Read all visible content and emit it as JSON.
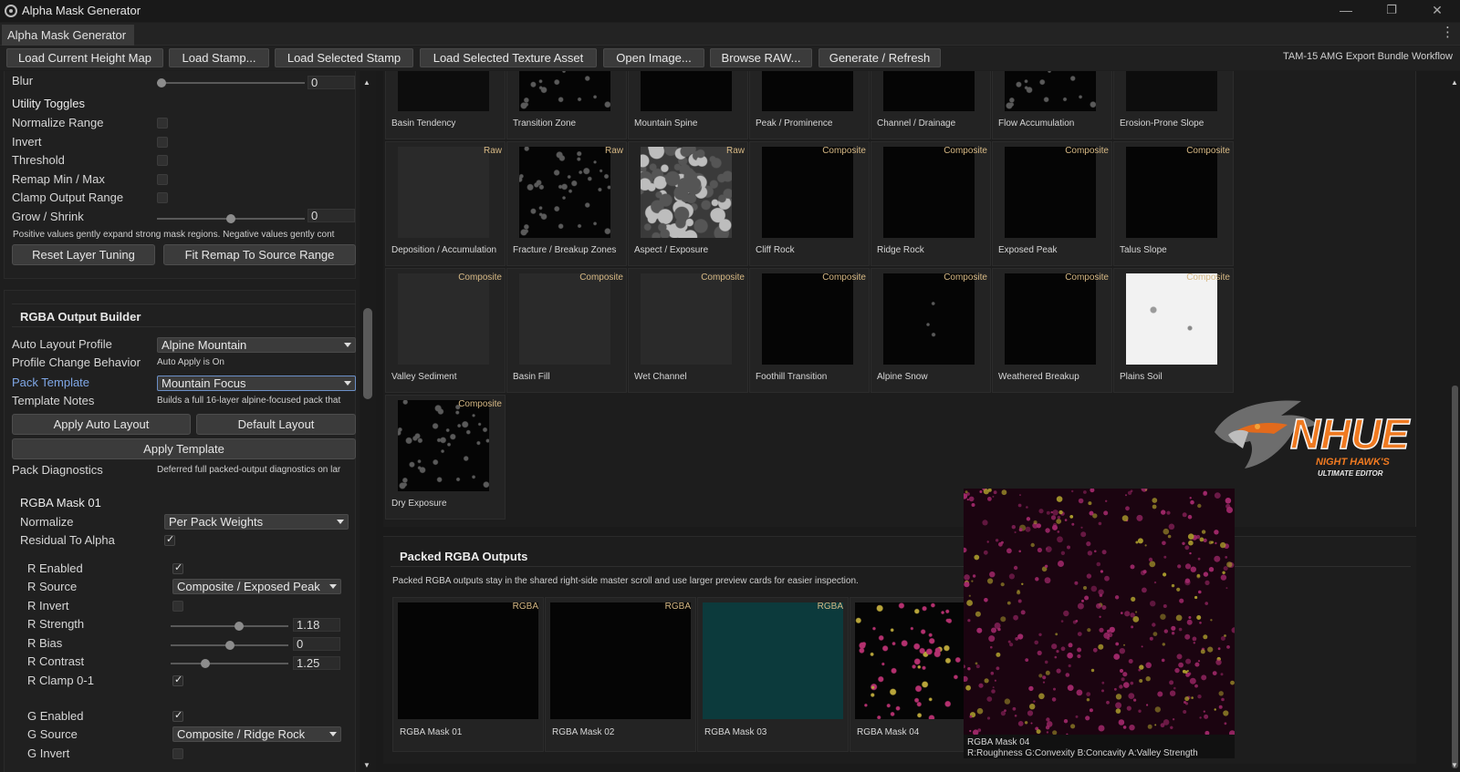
{
  "window": {
    "title": "Alpha Mask Generator",
    "minimize": "—",
    "maximize": "❐",
    "close": "✕"
  },
  "tabs": [
    {
      "label": "Alpha Mask Generator"
    }
  ],
  "tabbar": {
    "menu_glyph": "⋮"
  },
  "toolbar": {
    "buttons": [
      {
        "label": "Load Current Height Map"
      },
      {
        "label": "Load Stamp..."
      },
      {
        "label": "Load Selected Stamp"
      },
      {
        "label": "Load Selected Texture Asset"
      },
      {
        "label": "Open Image..."
      },
      {
        "label": "Browse RAW..."
      },
      {
        "label": "Generate / Refresh"
      }
    ],
    "right_label": "TAM-15 AMG Export Bundle Workflow"
  },
  "left": {
    "blur": {
      "label": "Blur",
      "value": "0",
      "level": 0.0
    },
    "utility_toggles": {
      "title": "Utility Toggles",
      "items": [
        {
          "label": "Normalize Range",
          "checked": false
        },
        {
          "label": "Invert",
          "checked": false
        },
        {
          "label": "Threshold",
          "checked": false
        },
        {
          "label": "Remap Min / Max",
          "checked": false
        },
        {
          "label": "Clamp Output Range",
          "checked": false
        }
      ]
    },
    "grow_shrink": {
      "label": "Grow / Shrink",
      "value": "0",
      "level": 0.5
    },
    "grow_note": "Positive values gently expand strong mask regions. Negative values gently cont",
    "reset_button": "Reset Layer Tuning",
    "fit_button": "Fit Remap To Source Range",
    "rgba_builder": {
      "title": "RGBA Output Builder",
      "auto_layout_profile": {
        "label": "Auto Layout Profile",
        "value": "Alpine Mountain"
      },
      "profile_change": {
        "label": "Profile Change Behavior",
        "value": "Auto Apply is On"
      },
      "pack_template": {
        "label": "Pack Template",
        "value": "Mountain Focus"
      },
      "template_notes": {
        "label": "Template Notes",
        "value": "Builds a full 16-layer alpine-focused pack that"
      },
      "apply_auto_layout": "Apply Auto Layout",
      "default_layout": "Default Layout",
      "apply_template": "Apply Template",
      "pack_diagnostics": {
        "label": "Pack Diagnostics",
        "value": "Deferred full packed-output diagnostics on lar"
      }
    },
    "mask01": {
      "title": "RGBA Mask 01",
      "normalize": {
        "label": "Normalize",
        "value": "Per Pack Weights"
      },
      "residual": {
        "label": "Residual To Alpha",
        "checked": true
      },
      "r_enabled": {
        "label": "R Enabled",
        "checked": true
      },
      "r_source": {
        "label": "R Source",
        "value": "Composite / Exposed Peak"
      },
      "r_invert": {
        "label": "R Invert",
        "checked": false
      },
      "r_strength": {
        "label": "R Strength",
        "value": "1.18",
        "level": 0.59
      },
      "r_bias": {
        "label": "R Bias",
        "value": "0",
        "level": 0.5
      },
      "r_contrast": {
        "label": "R Contrast",
        "value": "1.25",
        "level": 0.28
      },
      "r_clamp": {
        "label": "R Clamp 0-1",
        "checked": true
      },
      "g_enabled": {
        "label": "G Enabled",
        "checked": true
      },
      "g_source": {
        "label": "G Source",
        "value": "Composite / Ridge Rock"
      },
      "g_invert": {
        "label": "G Invert",
        "checked": false
      }
    }
  },
  "grid": {
    "cards": [
      {
        "label": "Basin Tendency",
        "badge": "",
        "thumb": "dark"
      },
      {
        "label": "Transition Zone",
        "badge": "",
        "thumb": "speckle"
      },
      {
        "label": "Mountain Spine",
        "badge": "",
        "thumb": "black"
      },
      {
        "label": "Peak / Prominence",
        "badge": "",
        "thumb": "black"
      },
      {
        "label": "Channel / Drainage",
        "badge": "",
        "thumb": "black"
      },
      {
        "label": "Flow Accumulation",
        "badge": "",
        "thumb": "speckle"
      },
      {
        "label": "Erosion-Prone Slope",
        "badge": "",
        "thumb": "dark"
      },
      {
        "label": "Deposition / Accumulation",
        "badge": "Raw",
        "thumb": "gray"
      },
      {
        "label": "Fracture / Breakup Zones",
        "badge": "Raw",
        "thumb": "speckle"
      },
      {
        "label": "Aspect / Exposure",
        "badge": "Raw",
        "thumb": "aspect"
      },
      {
        "label": "Cliff Rock",
        "badge": "Composite",
        "thumb": "black"
      },
      {
        "label": "Ridge Rock",
        "badge": "Composite",
        "thumb": "black"
      },
      {
        "label": "Exposed Peak",
        "badge": "Composite",
        "thumb": "black"
      },
      {
        "label": "Talus Slope",
        "badge": "Composite",
        "thumb": "black"
      },
      {
        "label": "Valley Sediment",
        "badge": "Composite",
        "thumb": "gray"
      },
      {
        "label": "Basin Fill",
        "badge": "Composite",
        "thumb": "gray"
      },
      {
        "label": "Wet Channel",
        "badge": "Composite",
        "thumb": "gray"
      },
      {
        "label": "Foothill Transition",
        "badge": "Composite",
        "thumb": "black"
      },
      {
        "label": "Alpine Snow",
        "badge": "Composite",
        "thumb": "snow"
      },
      {
        "label": "Weathered Breakup",
        "badge": "Composite",
        "thumb": "black"
      },
      {
        "label": "Plains Soil",
        "badge": "Composite",
        "thumb": "white"
      },
      {
        "label": "Dry Exposure",
        "badge": "Composite",
        "thumb": "speckle"
      }
    ]
  },
  "packed": {
    "title": "Packed RGBA Outputs",
    "description": "Packed RGBA outputs stay in the shared right-side master scroll and use larger preview cards for easier inspection.",
    "cards": [
      {
        "label": "RGBA Mask 01",
        "badge": "RGBA",
        "thumb": "black"
      },
      {
        "label": "RGBA Mask 02",
        "badge": "RGBA",
        "thumb": "black"
      },
      {
        "label": "RGBA Mask 03",
        "badge": "RGBA",
        "thumb": "teal"
      },
      {
        "label": "RGBA Mask 04",
        "badge": "",
        "thumb": "pink"
      }
    ]
  },
  "logo": {
    "brand": "NHUE",
    "line1": "NIGHT HAWK'S",
    "line2": "ULTIMATE EDITOR"
  },
  "preview": {
    "title": "RGBA Mask 04",
    "channels": "R:Roughness  G:Convexity  B:Concavity  A:Valley Strength"
  },
  "colors": {
    "accent_badge": "#d6b884",
    "active_label": "#7fa7e6",
    "teal_thumb": "#0c3a3c"
  }
}
